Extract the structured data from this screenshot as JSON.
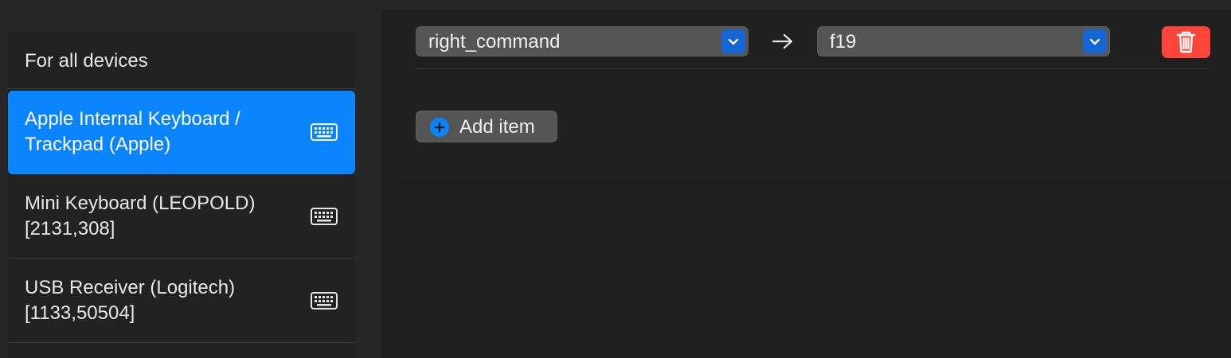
{
  "sidebar": {
    "header_label": "For all devices",
    "devices": [
      {
        "name": "Apple Internal Keyboard / Trackpad (Apple)",
        "icon": "keyboard-icon",
        "selected": true
      },
      {
        "name": "Mini Keyboard (LEOPOLD) [2131,308]",
        "icon": "keyboard-icon",
        "selected": false
      },
      {
        "name": "USB Receiver (Logitech) [1133,50504]",
        "icon": "keyboard-icon",
        "selected": false
      }
    ]
  },
  "main": {
    "mappings": [
      {
        "from_key": "right_command",
        "to_key": "f19",
        "arrow_icon": "arrow-right-icon",
        "delete_icon": "trash-icon"
      }
    ],
    "add_item_label": "Add item",
    "add_item_icon": "plus-circle-icon"
  },
  "colors": {
    "accent": "#0a84ff",
    "delete": "#ff453a",
    "popup_chevron": "#1466d6"
  }
}
